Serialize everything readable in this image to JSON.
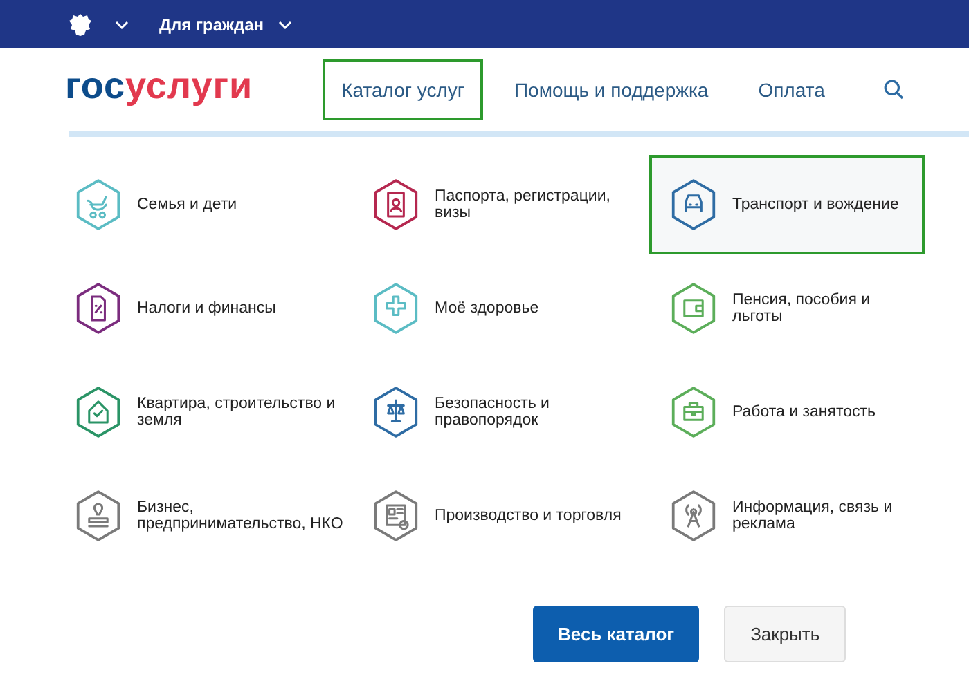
{
  "top_bar": {
    "menu_label": "Для граждан"
  },
  "header": {
    "logo": {
      "part_1": "гос",
      "part_2": "услуги"
    },
    "nav": [
      {
        "label": "Каталог услуг",
        "highlighted": true
      },
      {
        "label": "Помощь и поддержка",
        "highlighted": false
      },
      {
        "label": "Оплата",
        "highlighted": false
      }
    ]
  },
  "categories": [
    {
      "label": "Семья и дети",
      "color": "#5bbcc4",
      "highlighted": false
    },
    {
      "label": "Паспорта, регистрации, визы",
      "color": "#b5274f",
      "highlighted": false
    },
    {
      "label": "Транспорт и вождение",
      "color": "#2e6ca4",
      "highlighted": true
    },
    {
      "label": "Налоги и финансы",
      "color": "#7b2c7e",
      "highlighted": false
    },
    {
      "label": "Моё здоровье",
      "color": "#5bbcc4",
      "highlighted": false
    },
    {
      "label": "Пенсия, пособия и льготы",
      "color": "#5cae5a",
      "highlighted": false
    },
    {
      "label": "Квартира, строительство и земля",
      "color": "#2a9466",
      "highlighted": false
    },
    {
      "label": "Безопасность и правопорядок",
      "color": "#2e6ca4",
      "highlighted": false
    },
    {
      "label": "Работа и занятость",
      "color": "#5cae5a",
      "highlighted": false
    },
    {
      "label": "Бизнес, предпринимательство, НКО",
      "color": "#7a7a7a",
      "highlighted": false
    },
    {
      "label": "Производство и торговля",
      "color": "#7a7a7a",
      "highlighted": false
    },
    {
      "label": "Информация, связь и реклама",
      "color": "#7a7a7a",
      "highlighted": false
    }
  ],
  "buttons": [
    {
      "label": "Весь каталог",
      "kind": "primary"
    },
    {
      "label": "Закрыть",
      "kind": "secondary"
    }
  ]
}
